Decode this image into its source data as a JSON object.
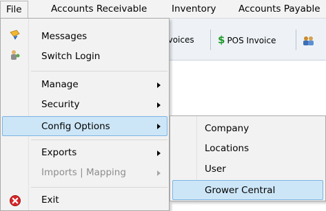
{
  "menubar": {
    "items": [
      {
        "label": "File"
      },
      {
        "label": "Accounts Receivable"
      },
      {
        "label": "Inventory"
      },
      {
        "label": "Accounts Payable"
      }
    ]
  },
  "toolbar": {
    "invoices_label": "nvoices",
    "pos_invoice_label": "POS Invoice"
  },
  "file_menu": {
    "items": [
      {
        "label": "Messages",
        "icon": "messages-icon"
      },
      {
        "label": "Switch Login",
        "icon": "switch-login-icon"
      },
      {
        "label": "Manage"
      },
      {
        "label": "Security"
      },
      {
        "label": "Config Options"
      },
      {
        "label": "Exports"
      },
      {
        "label": "Imports | Mapping"
      },
      {
        "label": "Exit",
        "icon": "exit-icon"
      }
    ]
  },
  "config_submenu": {
    "items": [
      {
        "label": "Company"
      },
      {
        "label": "Locations"
      },
      {
        "label": "User"
      },
      {
        "label": "Grower Central"
      }
    ]
  },
  "colors": {
    "highlight_fill": "#cde6f7",
    "highlight_border": "#7ab3e2",
    "menu_bg": "#f2f2f2",
    "exit_red": "#d8262a"
  }
}
